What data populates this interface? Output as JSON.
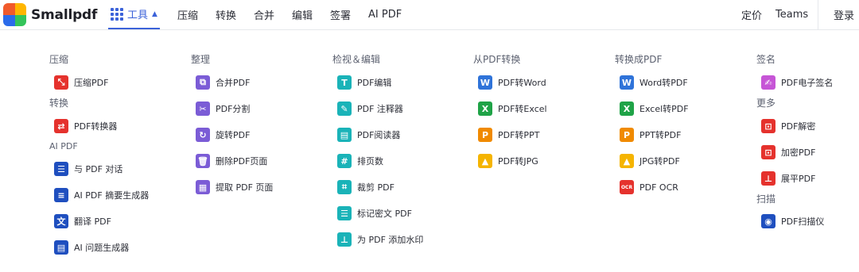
{
  "header": {
    "brand": "Smallpdf",
    "tools_label": "工具",
    "nav": [
      "压缩",
      "转换",
      "合并",
      "编辑",
      "签署",
      "AI PDF"
    ],
    "pricing": "定价",
    "teams": "Teams",
    "login": "登录"
  },
  "colors": {
    "accent": "#3b62d9",
    "red": "#e5322d",
    "purple": "#7b5cd6",
    "teal": "#1ab3b8",
    "blue_word": "#2f73d9",
    "green_excel": "#1fa347",
    "orange_ppt": "#f08a00",
    "yellow_jpg": "#f5b400",
    "pink_sign": "#c655d6",
    "dark_blue": "#1f4fbf"
  },
  "menu": {
    "compress": {
      "title": "压缩",
      "items": [
        "压缩PDF"
      ]
    },
    "convert": {
      "title": "转换",
      "items": [
        "PDF转换器"
      ]
    },
    "ai_pdf": {
      "title": "AI PDF",
      "items": [
        "与 PDF 对话",
        "AI PDF 摘要生成器",
        "翻译 PDF",
        "AI 问题生成器"
      ]
    },
    "organize": {
      "title": "整理",
      "items": [
        "合并PDF",
        "PDF分割",
        "旋转PDF",
        "删除PDF页面",
        "提取 PDF 页面"
      ]
    },
    "view_edit": {
      "title": "检视＆编辑",
      "items": [
        "PDF编辑",
        "PDF 注释器",
        "PDF阅读器",
        "排页数",
        "裁剪 PDF",
        "标记密文 PDF",
        "为 PDF 添加水印"
      ]
    },
    "from_pdf": {
      "title": "从PDF转换",
      "items": [
        "PDF转Word",
        "PDF转Excel",
        "PDF转PPT",
        "PDF转JPG"
      ]
    },
    "to_pdf": {
      "title": "转换成PDF",
      "items": [
        "Word转PDF",
        "Excel转PDF",
        "PPT转PDF",
        "JPG转PDF",
        "PDF OCR"
      ]
    },
    "sign": {
      "title": "签名",
      "items": [
        "PDF电子签名"
      ]
    },
    "more": {
      "title": "更多",
      "items": [
        "PDF解密",
        "加密PDF",
        "展平PDF"
      ]
    },
    "scan": {
      "title": "扫描",
      "items": [
        "PDF扫描仪"
      ]
    }
  },
  "icon_glyphs": {
    "word": "W",
    "excel": "X",
    "ppt": "P",
    "ocr": "OCR",
    "edit": "T"
  }
}
